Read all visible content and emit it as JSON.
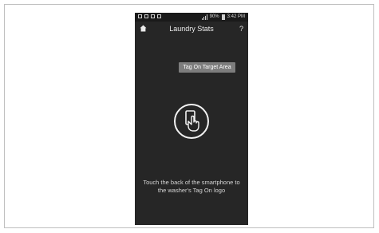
{
  "status_bar": {
    "battery_percent": "90%",
    "time": "3:42 PM"
  },
  "app_bar": {
    "title": "Laundry Stats",
    "help_label": "?"
  },
  "main": {
    "tag_button_label": "Tag On Target Area",
    "instruction": "Touch the back of the smartphone to the washer's Tag On logo"
  },
  "icons": {
    "home": "home-icon",
    "tag_on": "phone-hand-icon"
  }
}
